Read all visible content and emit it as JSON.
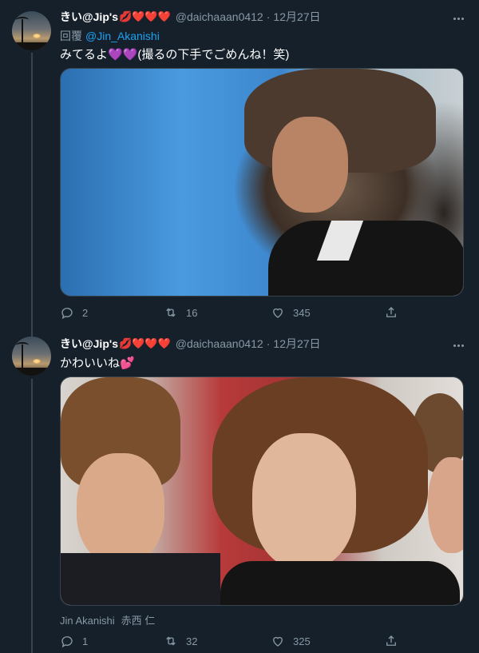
{
  "tweets": [
    {
      "author": {
        "name": "きい@Jip's",
        "name_emojis": "💋❤️❤️❤️",
        "handle": "@daichaaan0412",
        "separator": "·",
        "date": "12月27日"
      },
      "reply_label": "回覆",
      "reply_mention": "@Jin_Akanishi",
      "text": "みてるよ",
      "text_emojis": "💜💜",
      "text_after": "(撮るの下手でごめんね！笑)",
      "media_alt": "drama screenshot",
      "stats": {
        "replies": "2",
        "retweets": "16",
        "likes": "345"
      },
      "icons": {
        "reply": "speech-bubble-icon",
        "retweet": "retweet-icon",
        "like": "heart-icon",
        "share": "share-icon",
        "more": "more-dots-icon"
      }
    },
    {
      "author": {
        "name": "きい@Jip's",
        "name_emojis": "💋❤️❤️❤️",
        "handle": "@daichaaan0412",
        "separator": "·",
        "date": "12月27日"
      },
      "text": "かわいいね",
      "text_emojis": "💕",
      "media_alt": "drama screenshot",
      "media_tags": [
        "Jin Akanishi",
        "赤西 仁"
      ],
      "stats": {
        "replies": "1",
        "retweets": "32",
        "likes": "325"
      },
      "icons": {
        "reply": "speech-bubble-icon",
        "retweet": "retweet-icon",
        "like": "heart-icon",
        "share": "share-icon",
        "more": "more-dots-icon"
      }
    }
  ],
  "colors": {
    "background": "#15202b",
    "secondary_text": "#8899a6",
    "link": "#1da1f2",
    "thread_line": "#38444d"
  }
}
